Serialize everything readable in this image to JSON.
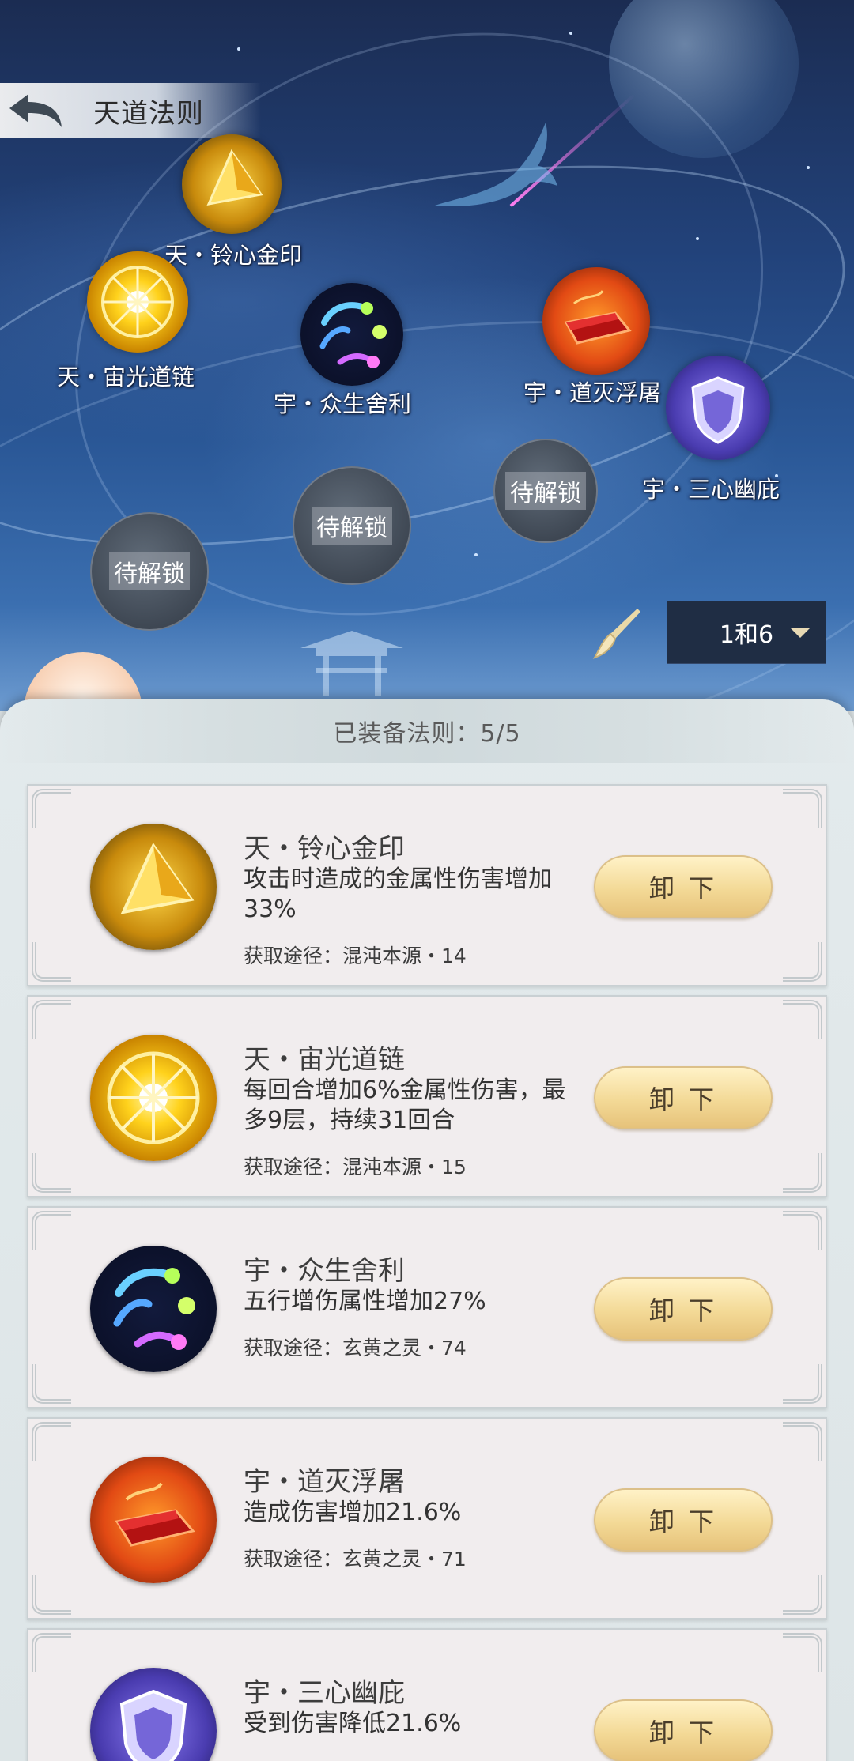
{
  "header": {
    "title": "天道法则",
    "back_icon": "back-arrow-icon"
  },
  "scene": {
    "nodes": [
      {
        "label": "天・铃心金印",
        "icon": "golden-pyramid-icon"
      },
      {
        "label": "天・宙光道链",
        "icon": "golden-sun-icon"
      },
      {
        "label": "宇・众生舍利",
        "icon": "comet-orb-icon"
      },
      {
        "label": "宇・道灭浮屠",
        "icon": "red-crystal-icon"
      },
      {
        "label": "宇・三心幽庇",
        "icon": "shield-icon"
      }
    ],
    "locked_label": "待解锁",
    "locked_count": 3,
    "selector_value": "1和6",
    "brush_icon": "brush-icon"
  },
  "panel": {
    "equipped_text": "已装备法则：5/5",
    "unequip_label": "卸 下",
    "cards": [
      {
        "name": "天・铃心金印",
        "desc": "攻击时造成的金属性伤害增加33%",
        "source": "获取途径：混沌本源・14",
        "icon": "golden-pyramid-icon"
      },
      {
        "name": "天・宙光道链",
        "desc": "每回合增加6%金属性伤害，最多9层，持续31回合",
        "source": "获取途径：混沌本源・15",
        "icon": "golden-sun-icon"
      },
      {
        "name": "宇・众生舍利",
        "desc": "五行增伤属性增加27%",
        "source": "获取途径：玄黄之灵・74",
        "icon": "comet-orb-icon"
      },
      {
        "name": "宇・道灭浮屠",
        "desc": "造成伤害增加21.6%",
        "source": "获取途径：玄黄之灵・71",
        "icon": "red-crystal-icon"
      },
      {
        "name": "宇・三心幽庇",
        "desc": "受到伤害降低21.6%",
        "source": "",
        "icon": "shield-icon"
      }
    ]
  },
  "colors": {
    "gold": "#f3d996",
    "panel_bg": "#e3eaec",
    "card_bg": "#f1edee",
    "sky_dark": "#1b2c52",
    "sky_light": "#6d9bd0"
  }
}
